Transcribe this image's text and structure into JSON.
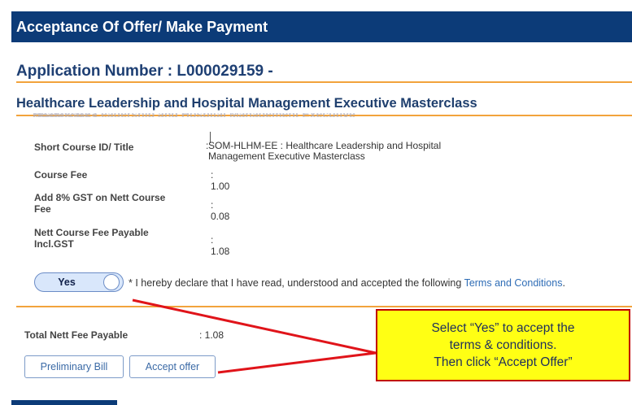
{
  "header": {
    "title": "Acceptance Of Offer/ Make Payment"
  },
  "application": {
    "number_label": "Application Number : L000029159 -"
  },
  "course": {
    "title": "Healthcare Leadership and Hospital Management Executive Masterclass",
    "details": [
      {
        "label": "Short Course ID/ Title",
        "value_line1": "SOM-HLHM-EE : Healthcare Leadership and Hospital",
        "value_line2": "Management Executive Masterclass"
      },
      {
        "label": "Course Fee",
        "value": ": 1.00"
      },
      {
        "label_line1": "Add 8% GST on Nett Course",
        "label_line2": "Fee",
        "value": ": 0.08"
      },
      {
        "label_line1": "Nett Course Fee Payable",
        "label_line2": "Incl.GST",
        "value": ": 1.08"
      }
    ]
  },
  "declaration": {
    "toggle_label": "Yes",
    "text": "* I hereby declare that I have read, understood and accepted the following ",
    "link_text": "Terms and Conditions",
    "end_punct": "."
  },
  "total": {
    "label": "Total Nett Fee Payable",
    "value": ": 1.08"
  },
  "buttons": {
    "preliminary_bill": "Preliminary Bill",
    "accept_offer": "Accept offer"
  },
  "annotation": {
    "line1": "Select “Yes” to accept the",
    "line2": "terms & conditions.",
    "line3": "Then click “Accept Offer”"
  },
  "colors": {
    "header": "#0c3b78",
    "accent_rule": "#f2a33c",
    "callout_fill": "#ffff14",
    "callout_border": "#c00000",
    "arrow": "#e0141a"
  }
}
